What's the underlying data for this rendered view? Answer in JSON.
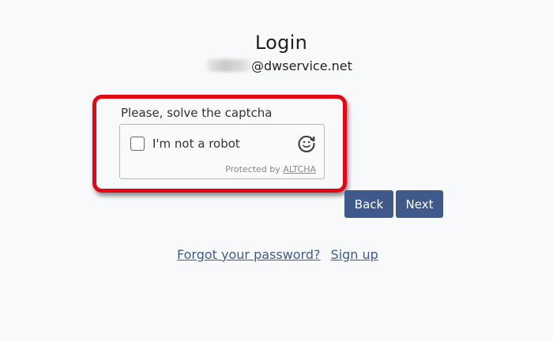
{
  "header": {
    "title": "Login",
    "email_domain": "@dwservice.net"
  },
  "captcha": {
    "prompt": "Please, solve the captcha",
    "checkbox_label": "I'm not a robot",
    "footer_prefix": "Protected by ",
    "footer_link": "ALTCHA",
    "logo_icon": "altcha-logo-icon",
    "highlight_color": "#e30613"
  },
  "buttons": {
    "back_label": "Back",
    "next_label": "Next",
    "color": "#3f5a8a"
  },
  "links": {
    "forgot_password": "Forgot your password?",
    "sign_up": "Sign up"
  }
}
